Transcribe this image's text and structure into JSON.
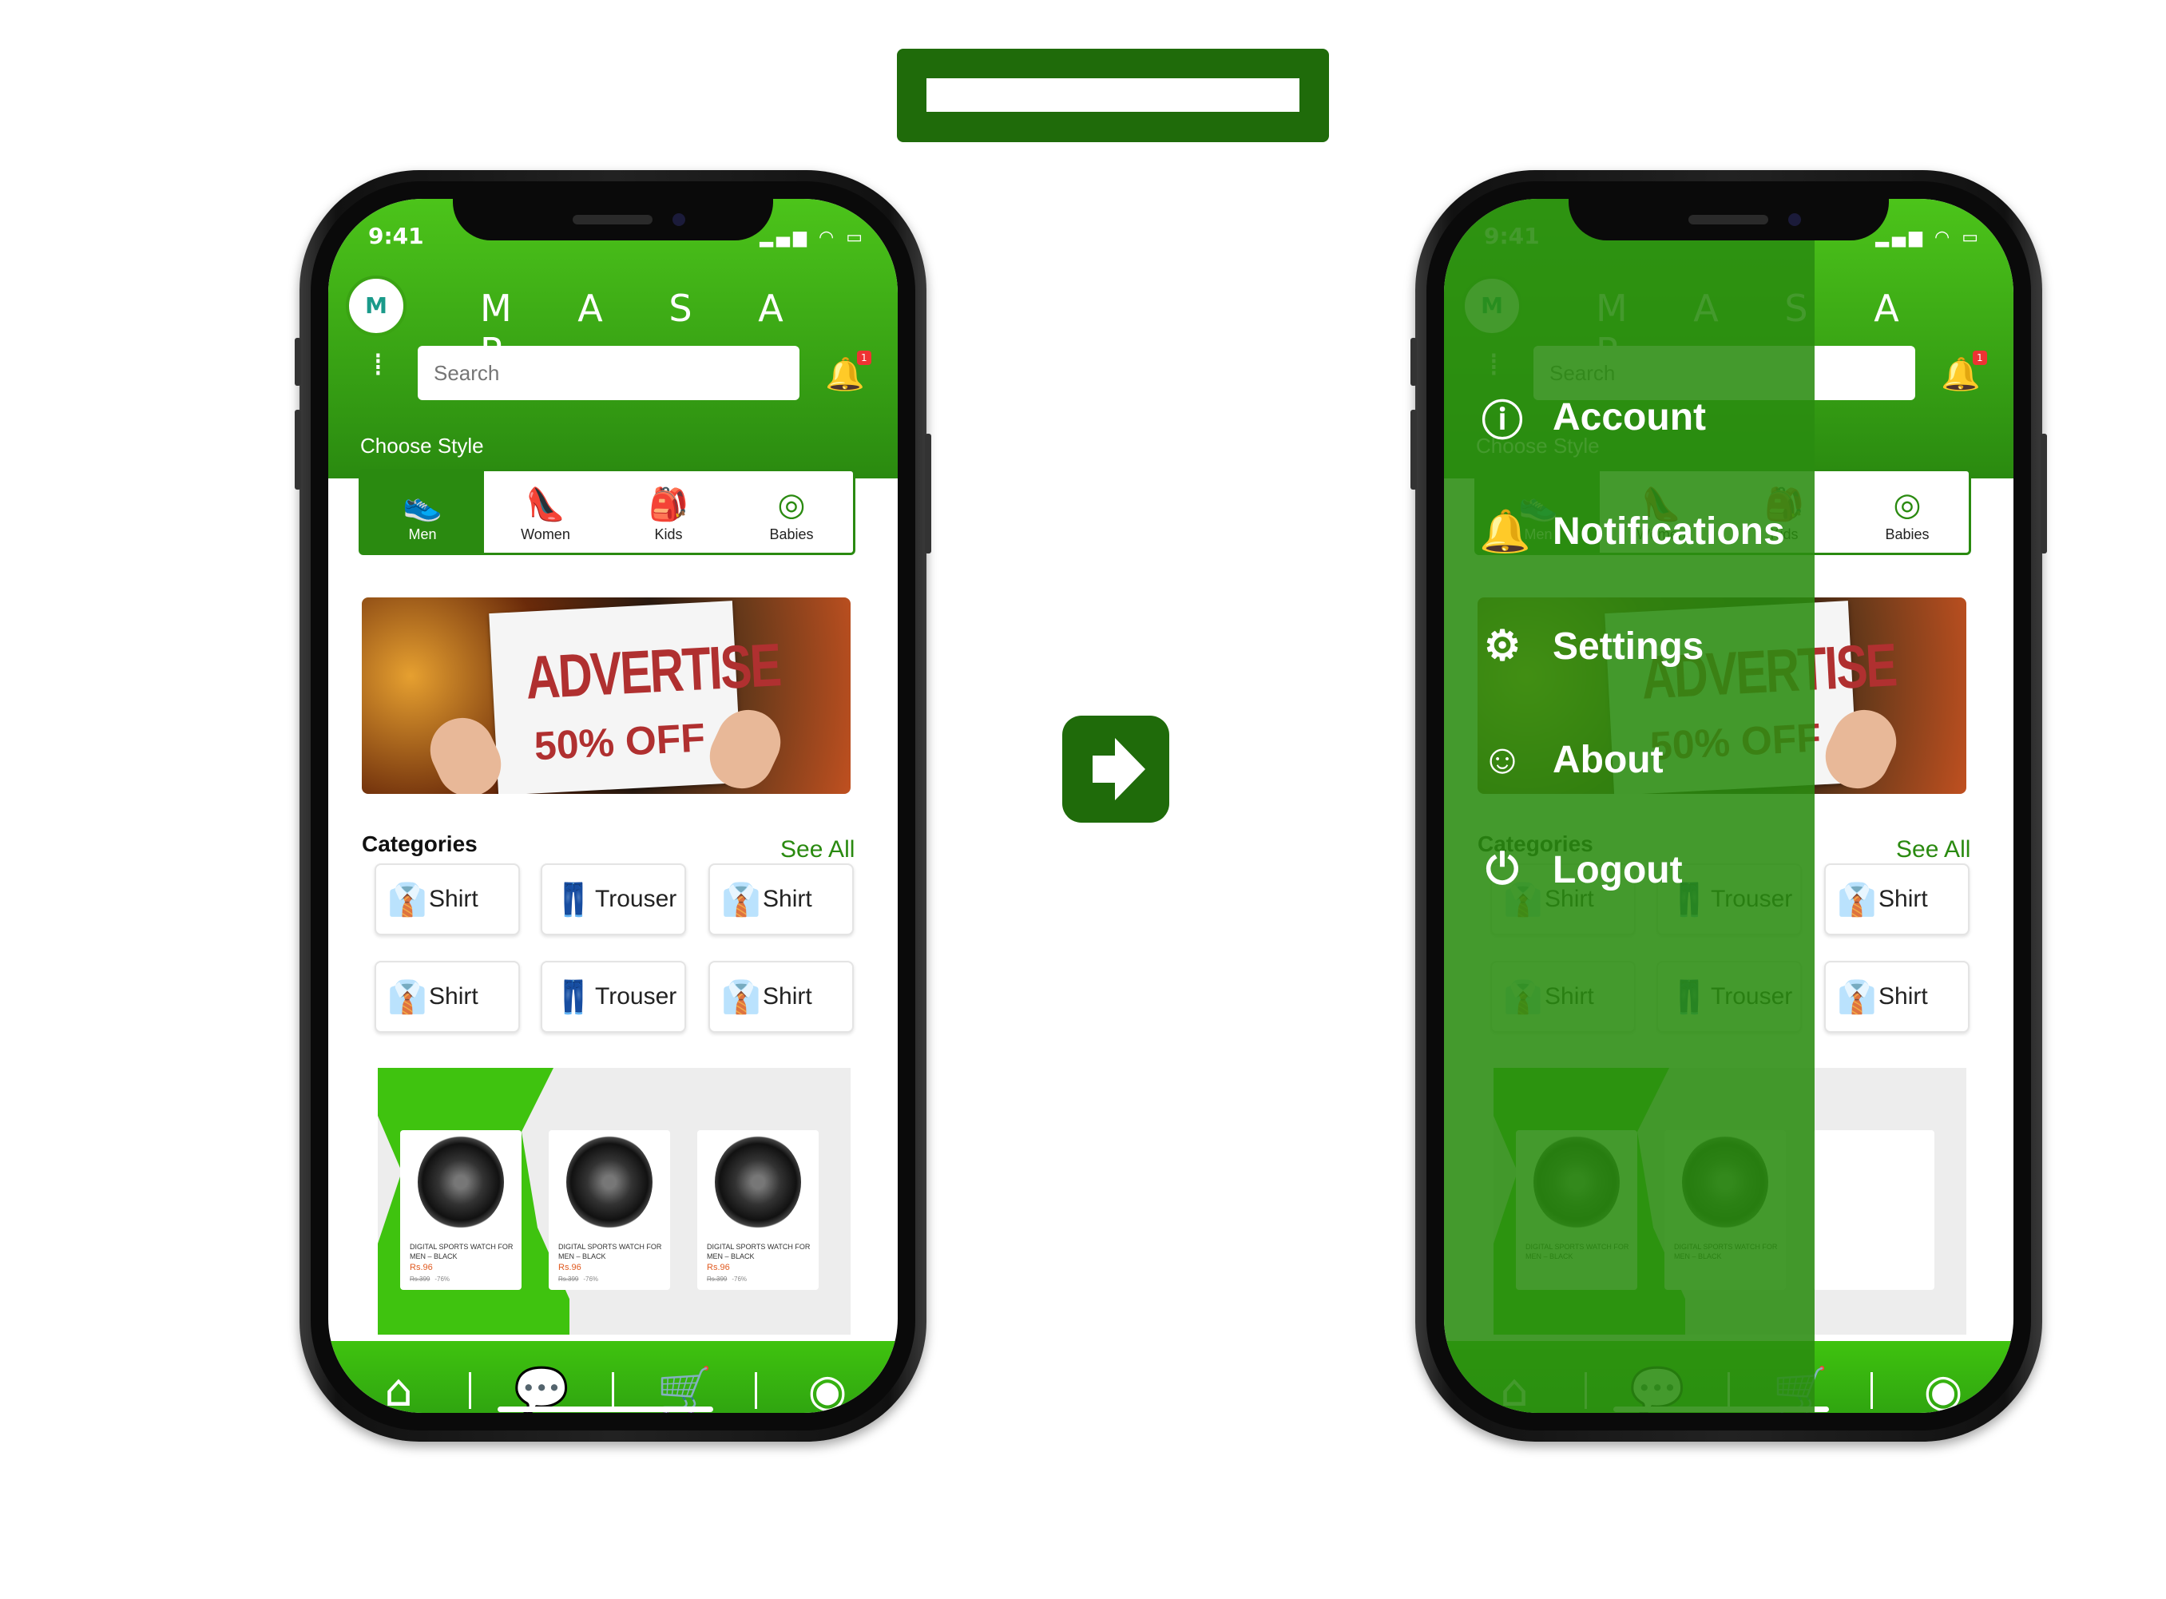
{
  "app": {
    "brand": "M A S A R",
    "logo": "M",
    "time": "9:41",
    "status_icons": "signal wifi battery",
    "search_placeholder": "Search",
    "notification_badge": "1",
    "choose_style_label": "Choose Style",
    "styles": [
      {
        "label": "Men",
        "icon": "shoe-icon"
      },
      {
        "label": "Women",
        "icon": "heel-icon"
      },
      {
        "label": "Kids",
        "icon": "backpack-icon"
      },
      {
        "label": "Babies",
        "icon": "pacifier-icon"
      }
    ],
    "banner": {
      "headline": "ADVERTISE",
      "offer": "50% OFF"
    },
    "categories_title": "Categories",
    "see_all": "See All",
    "categories": [
      "Shirt",
      "Trouser",
      "Shirt",
      "Shirt",
      "Trouser",
      "Shirt"
    ],
    "products": [
      {
        "title": "DIGITAL SPORTS WATCH FOR MEN – BLACK",
        "price": "Rs.96",
        "old_price": "Rs.399",
        "discount": "-76%"
      },
      {
        "title": "DIGITAL SPORTS WATCH FOR MEN – BLACK",
        "price": "Rs.96",
        "old_price": "Rs.399",
        "discount": "-76%"
      },
      {
        "title": "DIGITAL SPORTS WATCH FOR MEN – BLACK",
        "price": "Rs.96",
        "old_price": "Rs.399",
        "discount": "-76%"
      }
    ],
    "nav": [
      "home-icon",
      "chat-icon",
      "cart-icon",
      "profile-icon"
    ]
  },
  "drawer": {
    "items": [
      {
        "label": "Account",
        "icon": "info-icon"
      },
      {
        "label": "Notifications",
        "icon": "bell-icon"
      },
      {
        "label": "Settings",
        "icon": "gear-icon"
      },
      {
        "label": "About",
        "icon": "user-circle-icon"
      },
      {
        "label": "Logout",
        "icon": "power-icon"
      }
    ]
  },
  "colors": {
    "primary": "#3fc30f",
    "dark": "#1f6b0a",
    "accent": "#2a8a10",
    "price": "#e05a20"
  }
}
